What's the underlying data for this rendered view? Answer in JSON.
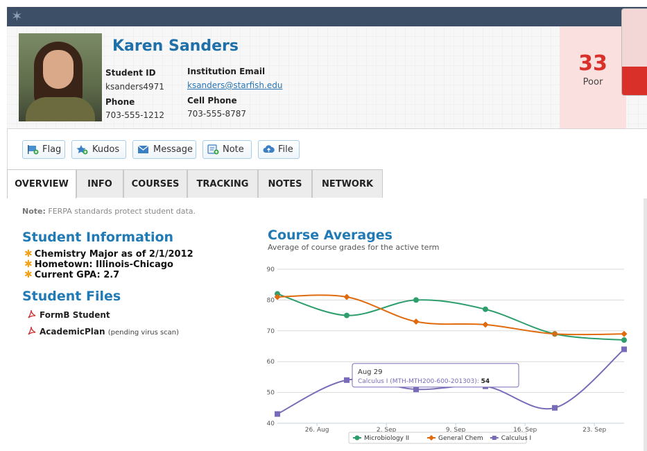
{
  "window": {
    "close_label": "✖"
  },
  "student": {
    "name": "Karen Sanders",
    "student_id_label": "Student ID",
    "student_id": "ksanders4971",
    "email_label": "Institution Email",
    "email": "ksanders@starfish.edu",
    "phone_label": "Phone",
    "phone": "703-555-1212",
    "cell_label": "Cell Phone",
    "cell": "703-555-8787"
  },
  "score": {
    "value": "33",
    "label": "Poor",
    "level": 0.33,
    "color": "#d9302a"
  },
  "toolbar": {
    "flag": "Flag",
    "kudos": "Kudos",
    "message": "Message",
    "note": "Note",
    "file": "File"
  },
  "tabs": [
    "OVERVIEW",
    "INFO",
    "COURSES",
    "TRACKING",
    "NOTES",
    "NETWORK"
  ],
  "active_tab": "OVERVIEW",
  "notice": {
    "prefix": "Note:",
    "text": " FERPA standards protect student data."
  },
  "student_info": {
    "heading": "Student Information",
    "items": [
      "Chemistry Major as of 2/1/2012",
      "Hometown: Illinois-Chicago",
      "Current GPA: 2.7"
    ]
  },
  "student_files": {
    "heading": "Student Files",
    "files": [
      {
        "name": "FormB Student",
        "status": ""
      },
      {
        "name": "AcademicPlan",
        "status": "(pending virus scan)"
      }
    ]
  },
  "chart_data": {
    "type": "line",
    "title": "Course Averages",
    "subtitle": "Average of course grades for the active term",
    "ylim": [
      40,
      90
    ],
    "yticks": [
      40,
      50,
      60,
      70,
      80,
      90
    ],
    "xlim": [
      "Aug 22",
      "Sep 26"
    ],
    "xticks": [
      "26. Aug",
      "2. Sep",
      "9. Sep",
      "16. Sep",
      "23. Sep"
    ],
    "grid": true,
    "legend_position": "bottom-center",
    "series": [
      {
        "name": "Microbiology II",
        "color": "#2e9e6d",
        "marker": "circle",
        "x": [
          "Aug 22",
          "Aug 29",
          "Sep 5",
          "Sep 12",
          "Sep 19",
          "Sep 26"
        ],
        "y": [
          82,
          75,
          80,
          77,
          69,
          67
        ]
      },
      {
        "name": "General Chem",
        "color": "#e06a0e",
        "marker": "diamond",
        "x": [
          "Aug 22",
          "Aug 29",
          "Sep 5",
          "Sep 12",
          "Sep 19",
          "Sep 26"
        ],
        "y": [
          81,
          81,
          73,
          72,
          69,
          69
        ]
      },
      {
        "name": "Calculus I",
        "color": "#7a6bb8",
        "marker": "square",
        "x": [
          "Aug 22",
          "Aug 29",
          "Sep 5",
          "Sep 12",
          "Sep 19",
          "Sep 26"
        ],
        "y": [
          43,
          54,
          51,
          52,
          45,
          64
        ]
      }
    ],
    "tooltip": {
      "date": "Aug 29",
      "series": "Calculus I (MTH-MTH200-600-201303)",
      "value": "54"
    }
  }
}
